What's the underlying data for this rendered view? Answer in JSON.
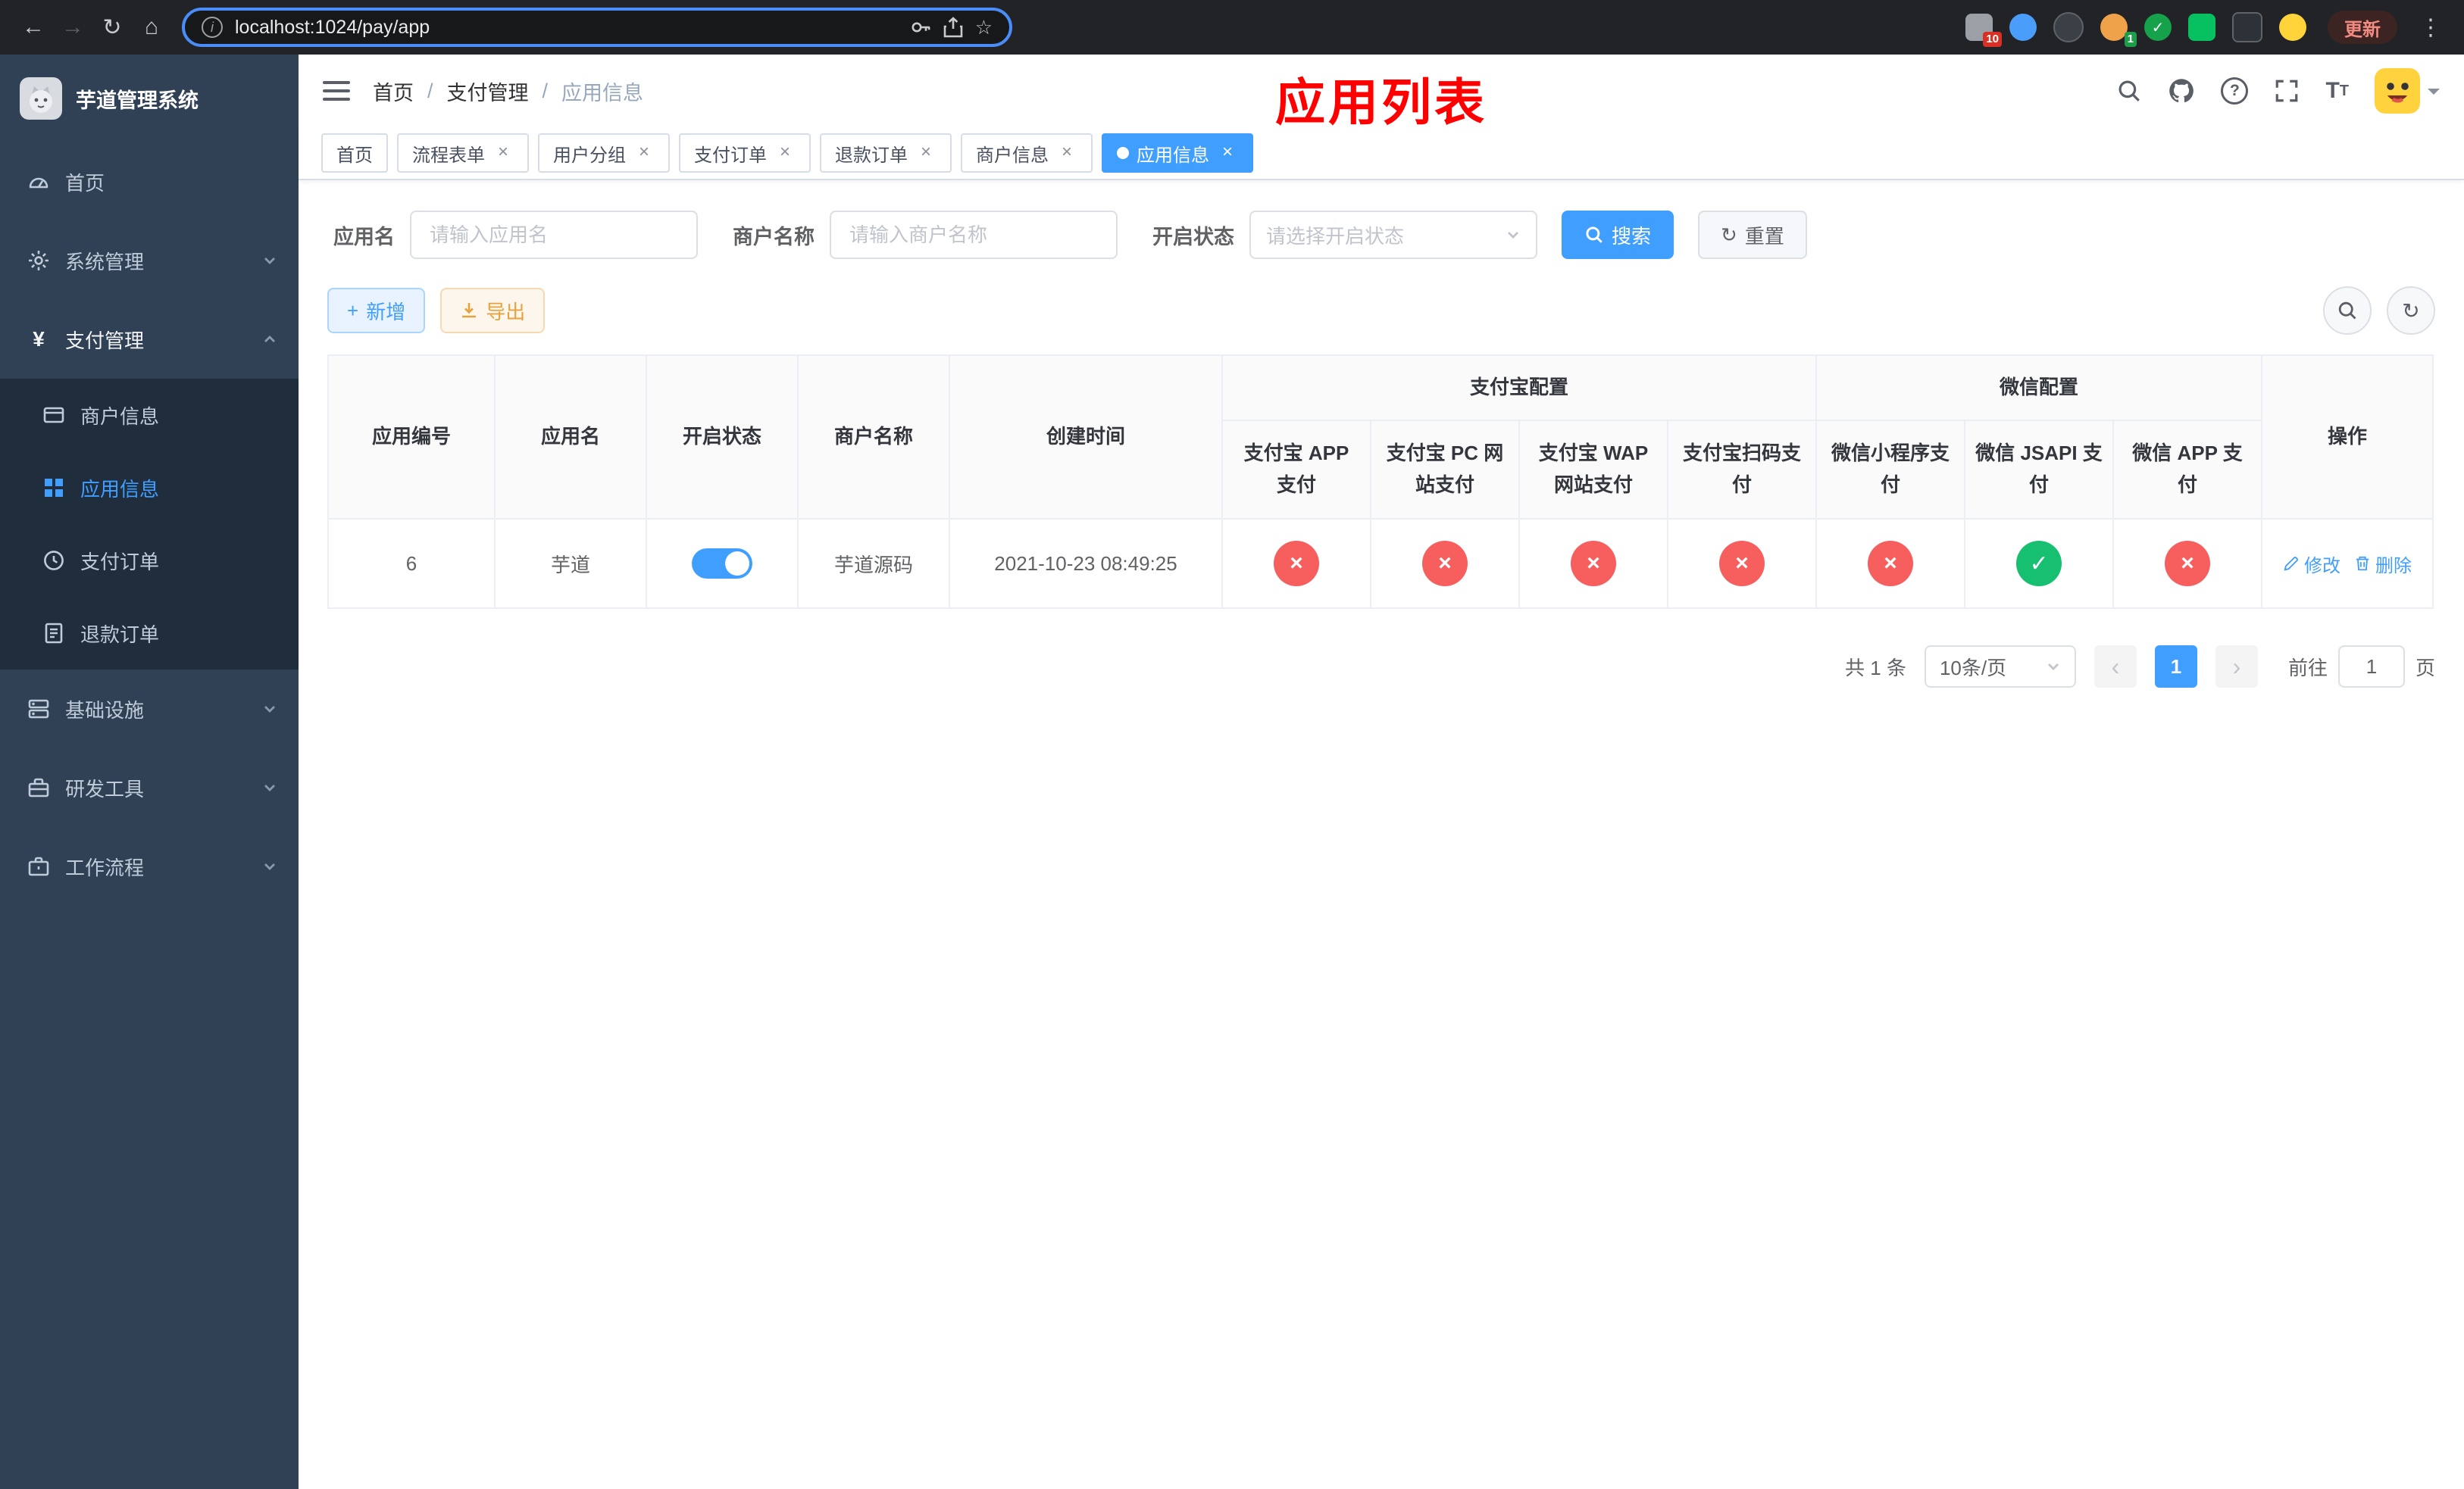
{
  "icons": {
    "back": "←",
    "forward": "→",
    "reload": "↻",
    "home": "⌂",
    "star": "☆",
    "kebab": "⋮",
    "check": "✓",
    "cross": "×",
    "plus": "+",
    "reset": "↻",
    "refresh": "↻",
    "prev": "‹",
    "next": "›",
    "yen": "¥",
    "question": "?",
    "font_size": "T",
    "info": "i"
  },
  "browser": {
    "url": "localhost:1024/pay/app",
    "update_label": "更新",
    "extension_badge_1": "10",
    "extension_badge_2": "1"
  },
  "sidebar": {
    "brand": "芋道管理系统",
    "items": [
      {
        "label": "首页"
      },
      {
        "label": "系统管理"
      },
      {
        "label": "支付管理"
      },
      {
        "label": "商户信息"
      },
      {
        "label": "应用信息"
      },
      {
        "label": "支付订单"
      },
      {
        "label": "退款订单"
      },
      {
        "label": "基础设施"
      },
      {
        "label": "研发工具"
      },
      {
        "label": "工作流程"
      }
    ]
  },
  "header": {
    "breadcrumb": [
      "首页",
      "支付管理",
      "应用信息"
    ],
    "page_title": "应用列表"
  },
  "tabs": [
    {
      "label": "首页",
      "closable": false,
      "active": false
    },
    {
      "label": "流程表单",
      "closable": true,
      "active": false
    },
    {
      "label": "用户分组",
      "closable": true,
      "active": false
    },
    {
      "label": "支付订单",
      "closable": true,
      "active": false
    },
    {
      "label": "退款订单",
      "closable": true,
      "active": false
    },
    {
      "label": "商户信息",
      "closable": true,
      "active": false
    },
    {
      "label": "应用信息",
      "closable": true,
      "active": true
    }
  ],
  "filters": {
    "app_name_label": "应用名",
    "app_name_placeholder": "请输入应用名",
    "merchant_label": "商户名称",
    "merchant_placeholder": "请输入商户名称",
    "status_label": "开启状态",
    "status_placeholder": "请选择开启状态",
    "search_label": "搜索",
    "reset_label": "重置"
  },
  "toolbar": {
    "add_label": "新增",
    "export_label": "导出"
  },
  "table": {
    "groups": {
      "alipay": "支付宝配置",
      "wechat": "微信配置"
    },
    "columns": [
      "应用编号",
      "应用名",
      "开启状态",
      "商户名称",
      "创建时间",
      "支付宝 APP 支付",
      "支付宝 PC 网站支付",
      "支付宝 WAP 网站支付",
      "支付宝扫码支付",
      "微信小程序支付",
      "微信 JSAPI 支付",
      "微信 APP 支付",
      "操作"
    ],
    "row": {
      "id": "6",
      "name": "芋道",
      "status_on": true,
      "merchant": "芋道源码",
      "created_at": "2021-10-23 08:49:25",
      "configs": [
        false,
        false,
        false,
        false,
        false,
        true,
        false
      ],
      "edit_label": "修改",
      "delete_label": "删除"
    }
  },
  "pagination": {
    "total": "共 1 条",
    "page_size": "10条/页",
    "current_page": "1",
    "goto_label": "前往",
    "goto_value": "1",
    "goto_suffix": "页"
  }
}
